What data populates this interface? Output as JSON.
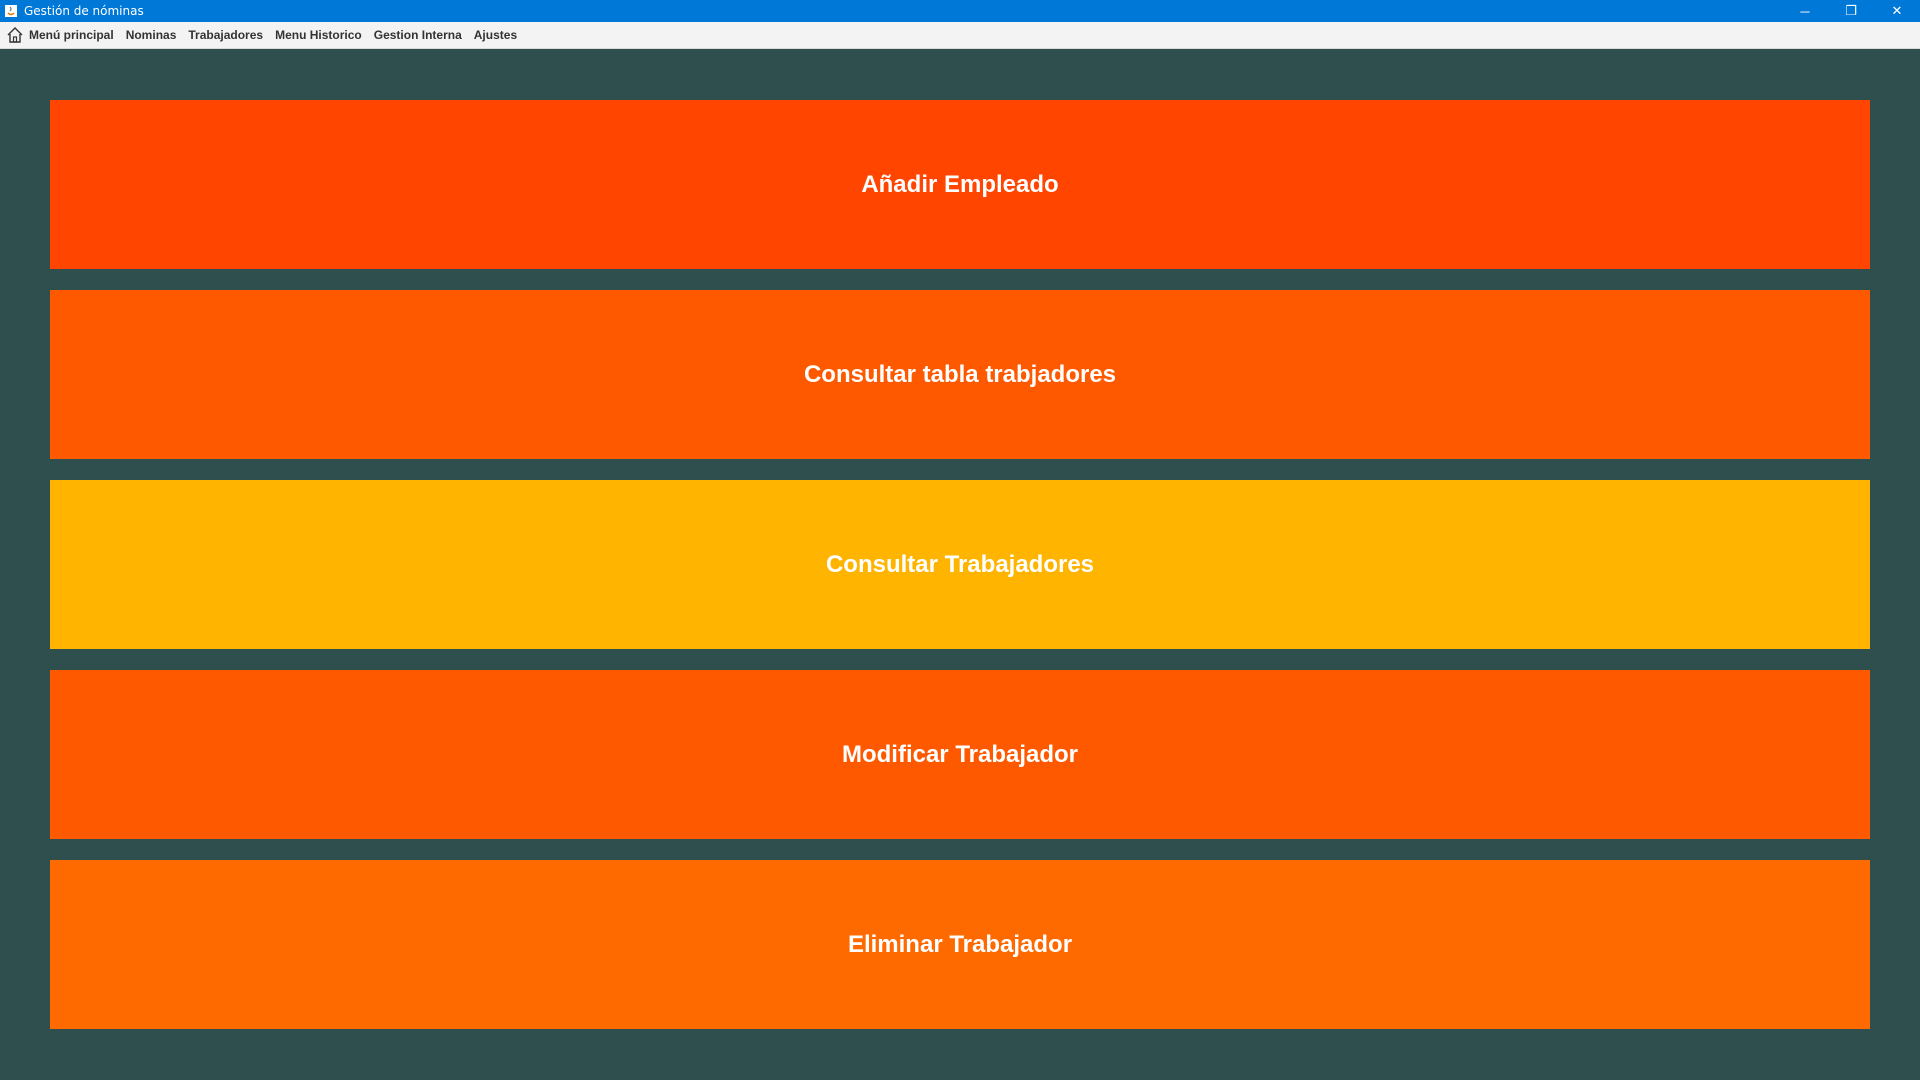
{
  "window": {
    "title": "Gestión de nóminas",
    "controls": {
      "minimize": "─",
      "restore": "❐",
      "close": "✕"
    }
  },
  "menubar": {
    "items": [
      {
        "label": "Menú principal",
        "icon": "home-icon"
      },
      {
        "label": "Nominas"
      },
      {
        "label": "Trabajadores"
      },
      {
        "label": "Menu Historico"
      },
      {
        "label": "Gestion Interna"
      },
      {
        "label": "Ajustes"
      }
    ]
  },
  "main": {
    "buttons": [
      {
        "label": "Añadir Empleado",
        "color": "#ff4500"
      },
      {
        "label": "Consultar tabla trabjadores",
        "color": "#ff5900"
      },
      {
        "label": "Consultar Trabajadores",
        "color": "#ffb400"
      },
      {
        "label": "Modificar Trabajador",
        "color": "#ff5900"
      },
      {
        "label": "Eliminar Trabajador",
        "color": "#ff6a00"
      }
    ],
    "background": "#2f4f4f"
  },
  "colors": {
    "titlebar": "#0078d7",
    "menubar": "#f3f3f3"
  }
}
